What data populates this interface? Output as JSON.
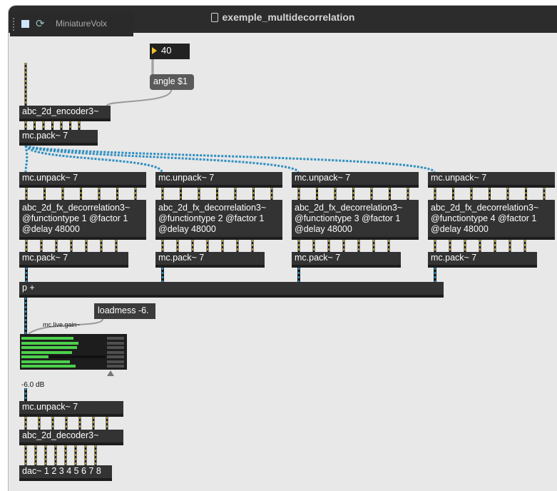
{
  "window": {
    "title": "exemple_multidecorrelation"
  },
  "colors": {
    "close": "#fe5f57",
    "minimize": "#febc2e",
    "zoom": "#28c840",
    "audio_patch": "#e2c23a",
    "mc_patch": "#2f8fc0",
    "object_bg": "#333333"
  },
  "player": {
    "filename": "MiniatureVolx"
  },
  "number_box": {
    "value": "40"
  },
  "message_angle": {
    "label": "angle $1"
  },
  "encoder": {
    "label": "abc_2d_encoder3~"
  },
  "pack_top": {
    "label": "mc.pack~ 7"
  },
  "unpack_1": {
    "label": "mc.unpack~ 7"
  },
  "unpack_2": {
    "label": "mc.unpack~ 7"
  },
  "unpack_3": {
    "label": "mc.unpack~ 7"
  },
  "unpack_4": {
    "label": "mc.unpack~ 7"
  },
  "decorr_1": {
    "label": "abc_2d_fx_decorrelation3~\n@functiontype 1 @factor 1\n@delay 48000"
  },
  "decorr_2": {
    "label": "abc_2d_fx_decorrelation3~\n@functiontype 2 @factor 1\n@delay 48000"
  },
  "decorr_3": {
    "label": "abc_2d_fx_decorrelation3~\n@functiontype 3 @factor 1\n@delay 48000"
  },
  "decorr_4": {
    "label": "abc_2d_fx_decorrelation3~\n@functiontype 4 @factor 1\n@delay 48000"
  },
  "pack_1": {
    "label": "mc.pack~ 7"
  },
  "pack_2": {
    "label": "mc.pack~ 7"
  },
  "pack_3": {
    "label": "mc.pack~ 7"
  },
  "pack_4": {
    "label": "mc.pack~ 7"
  },
  "sum": {
    "label": "p +"
  },
  "loadmess": {
    "label": "loadmess -6."
  },
  "gain": {
    "label": "mc.live.gain~",
    "value_text": "-6.0 dB"
  },
  "unpack_bottom": {
    "label": "mc.unpack~ 7"
  },
  "decoder": {
    "label": "abc_2d_decoder3~"
  },
  "dac": {
    "label": "dac~ 1 2 3 4 5 6 7 8"
  }
}
